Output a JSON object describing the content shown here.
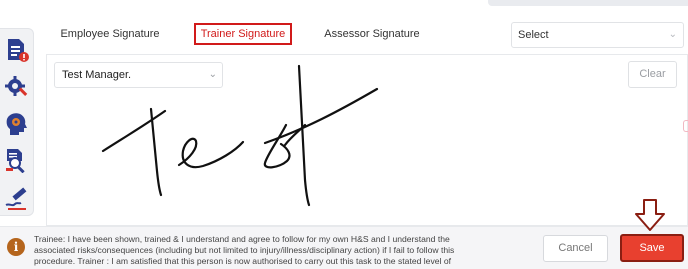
{
  "tabs": [
    {
      "label": "Employee Signature",
      "active": false
    },
    {
      "label": "Trainer Signature",
      "active": true
    },
    {
      "label": "Assessor Signature",
      "active": false
    }
  ],
  "select": {
    "value": "Select",
    "chevron_icon": "chevron-down-icon"
  },
  "signature": {
    "manager_value": "Test Manager.",
    "clear_label": "Clear",
    "handwriting": "Test"
  },
  "sidebar": {
    "icons": [
      "document-alert-icon",
      "gear-wrench-icon",
      "head-gear-icon",
      "document-search-icon",
      "signature-pen-icon"
    ]
  },
  "footer": {
    "info_glyph": "i",
    "trainee_text": "Trainee: I have been shown, trained & I understand and agree to follow for my own H&S and I understand the associated risks/consequences (including but not limited to injury/illness/disciplinary action) if I fail to follow this procedure. Trainer : I am satisfied that this person is now authorised to carry out this task to the stated level of competency",
    "cancel_label": "Cancel",
    "save_label": "Save"
  },
  "colors": {
    "accent_red": "#d11a1a",
    "save_bg": "#e8402f",
    "icon_blue": "#2d3f8f",
    "info_brown": "#b5651d"
  }
}
